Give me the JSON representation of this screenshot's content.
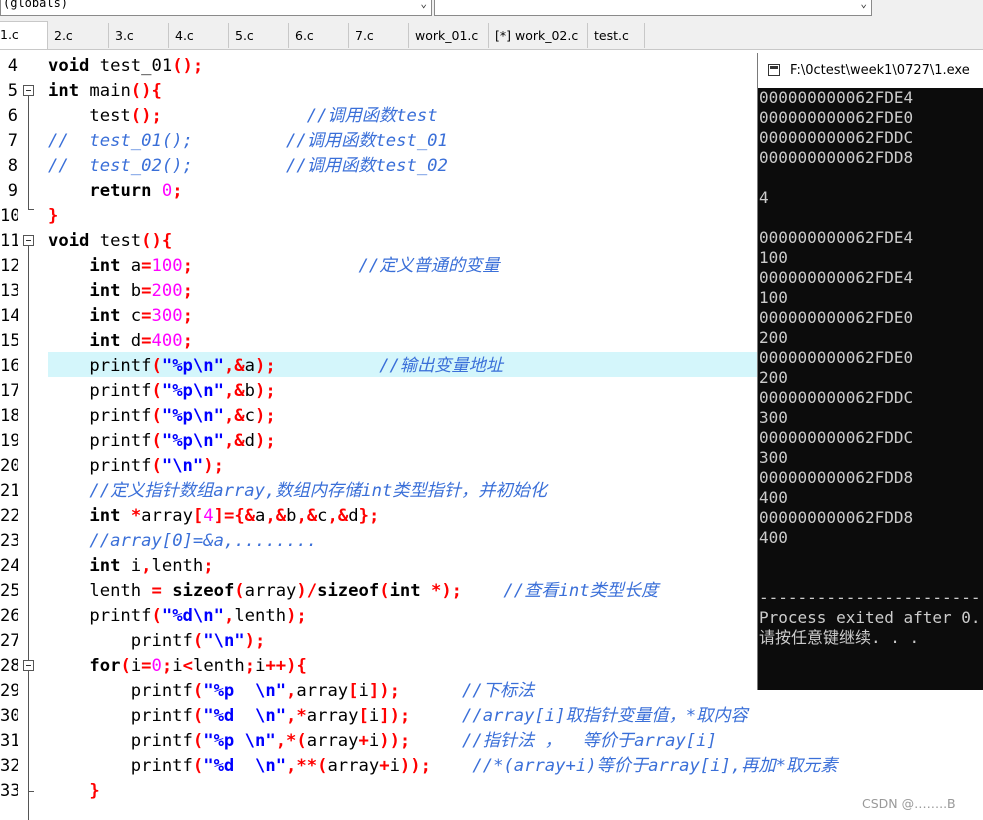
{
  "toolbar": {
    "scope_combo_value": "(globals)"
  },
  "tabs": [
    {
      "label": "1.c",
      "active": true
    },
    {
      "label": "2.c"
    },
    {
      "label": "3.c"
    },
    {
      "label": "4.c"
    },
    {
      "label": "5.c"
    },
    {
      "label": "6.c"
    },
    {
      "label": "7.c"
    },
    {
      "label": "work_01.c"
    },
    {
      "label": "[*] work_02.c"
    },
    {
      "label": "test.c"
    }
  ],
  "editor": {
    "highlighted_line": "16",
    "line_numbers": [
      "4",
      "5",
      "6",
      "7",
      "8",
      "9",
      "10",
      "11",
      "12",
      "13",
      "14",
      "15",
      "16",
      "17",
      "18",
      "19",
      "20",
      "21",
      "22",
      "23",
      "24",
      "25",
      "26",
      "27",
      "28",
      "29",
      "30",
      "31",
      "32",
      "33"
    ]
  },
  "console": {
    "title": "F:\\0ctest\\week1\\0727\\1.exe",
    "lines": [
      "000000000062FDE4",
      "000000000062FDE0",
      "000000000062FDDC",
      "000000000062FDD8",
      "",
      "4",
      "",
      "000000000062FDE4",
      "100",
      "000000000062FDE4",
      "100",
      "000000000062FDE0",
      "200",
      "000000000062FDE0",
      "200",
      "000000000062FDDC",
      "300",
      "000000000062FDDC",
      "300",
      "000000000062FDD8",
      "400",
      "000000000062FDD8",
      "400",
      "",
      "",
      "--------------------------------",
      "Process exited after 0.",
      "请按任意键继续. . ."
    ]
  },
  "watermark": "CSDN @……..B"
}
